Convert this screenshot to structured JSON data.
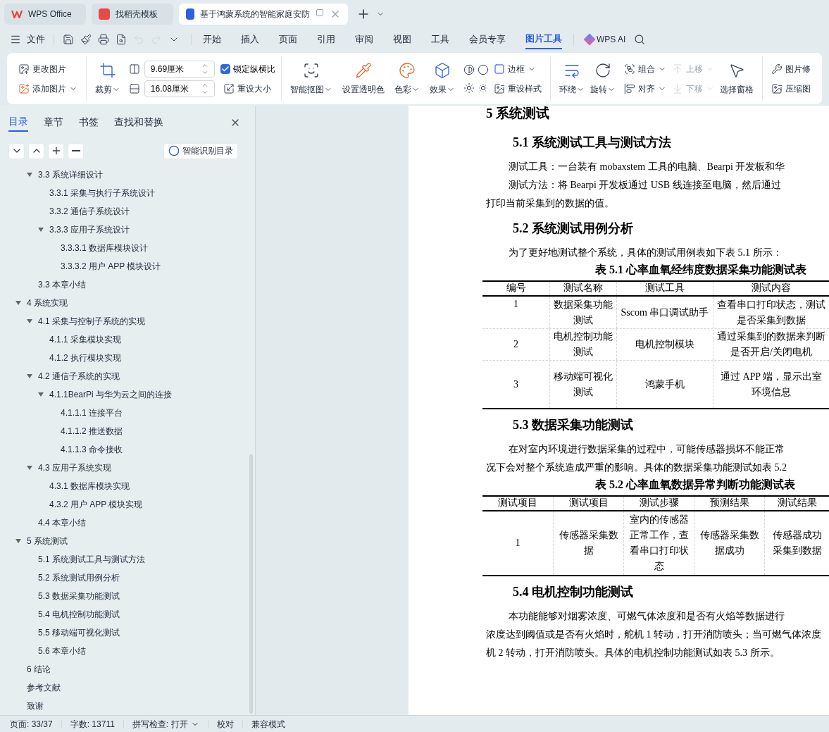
{
  "title_tabs": [
    {
      "label": "WPS Office",
      "kind": "home",
      "selected": false
    },
    {
      "label": "找稻壳模板",
      "kind": "template",
      "selected": false
    },
    {
      "label": "基于鸿蒙系统的智能家庭安防",
      "kind": "doc",
      "selected": true
    }
  ],
  "menu": {
    "file": "文件",
    "tabs": [
      {
        "label": "开始",
        "selected": false
      },
      {
        "label": "插入",
        "selected": false
      },
      {
        "label": "页面",
        "selected": false
      },
      {
        "label": "引用",
        "selected": false
      },
      {
        "label": "审阅",
        "selected": false
      },
      {
        "label": "视图",
        "selected": false
      },
      {
        "label": "工具",
        "selected": false
      },
      {
        "label": "会员专享",
        "selected": false
      },
      {
        "label": "图片工具",
        "selected": true
      }
    ],
    "ai": "WPS AI"
  },
  "ribbon": {
    "picture": [
      "更改图片",
      "添加图片"
    ],
    "crop": "裁剪",
    "height": "9.69厘米",
    "width": "16.08厘米",
    "lock": {
      "label": "锁定纵横比",
      "checked": true
    },
    "reset_size": "重设大小",
    "adjust": [
      "智能抠图",
      "设置透明色",
      "色彩",
      "效果"
    ],
    "border": "边框",
    "reset_style": "重设样式",
    "arrange": [
      "环绕",
      "旋转"
    ],
    "group": "组合",
    "align": "对齐",
    "up": {
      "label": "上移",
      "disabled": true
    },
    "down": {
      "label": "下移",
      "disabled": true
    },
    "pane": "选择窗格",
    "more": [
      "图片修",
      "压缩图"
    ]
  },
  "nav": {
    "tabs": [
      {
        "label": "目录",
        "selected": true
      },
      {
        "label": "章节",
        "selected": false
      },
      {
        "label": "书签",
        "selected": false
      },
      {
        "label": "查找和替换",
        "selected": false
      }
    ],
    "smart": "智能识别目录",
    "continued": [
      {
        "label": "3.3 系统详细设计",
        "expanded": true,
        "children": [
          {
            "label": "3.3.1 采集与执行子系统设计"
          },
          {
            "label": "3.3.2 通信子系统设计"
          },
          {
            "label": "3.3.3 应用子系统设计",
            "expanded": true,
            "children": [
              {
                "label": "3.3.3.1 数据库模块设计"
              },
              {
                "label": "3.3.3.2 用户 APP 模块设计"
              }
            ]
          }
        ]
      },
      {
        "label": "3.3 本章小结"
      }
    ],
    "items": [
      {
        "label": "4 系统实现",
        "expanded": true,
        "children": [
          {
            "label": "4.1 采集与控制子系统的实现",
            "expanded": true,
            "children": [
              {
                "label": "4.1.1 采集模块实现"
              },
              {
                "label": "4.1.2 执行模块实现"
              }
            ]
          },
          {
            "label": "4.2 通信子系统的实现",
            "expanded": true,
            "children": [
              {
                "label": "4.1.1BearPi 与华为云之间的连接",
                "expanded": true,
                "children": [
                  {
                    "label": "4.1.1.1 连接平台"
                  },
                  {
                    "label": "4.1.1.2 推送数据"
                  },
                  {
                    "label": "4.1.1.3 命令接收"
                  }
                ]
              }
            ]
          },
          {
            "label": "4.3 应用子系统实现",
            "expanded": true,
            "children": [
              {
                "label": "4.3.1 数据库模块实现"
              },
              {
                "label": "4.3.2 用户 APP 模块实现"
              }
            ]
          },
          {
            "label": "4.4 本章小结"
          }
        ]
      },
      {
        "label": "5 系统测试",
        "expanded": true,
        "children": [
          {
            "label": "5.1 系统测试工具与测试方法"
          },
          {
            "label": "5.2 系统测试用例分析"
          },
          {
            "label": "5.3 数据采集功能测试"
          },
          {
            "label": "5.4 电机控制功能测试"
          },
          {
            "label": "5.5 移动端可视化测试"
          },
          {
            "label": "5.6 本章小结"
          }
        ]
      },
      {
        "label": "6 结论"
      },
      {
        "label": "参考文献"
      },
      {
        "label": "致谢"
      }
    ]
  },
  "document": [
    {
      "kind": "chapter",
      "text": "5 系统测试"
    },
    {
      "kind": "heading",
      "text": "5.1 系统测试工具与测试方法"
    },
    {
      "kind": "para",
      "lines": [
        "测试工具：一台装有 mobaxstem 工具的电脑、Bearpi 开发板和华"
      ]
    },
    {
      "kind": "para",
      "lines": [
        "测试方法：将 Bearpi 开发板通过 USB 线连接至电脑，然后通过",
        "打印当前采集到的数据的值。"
      ]
    },
    {
      "kind": "heading",
      "text": "5.2 系统测试用例分析"
    },
    {
      "kind": "para",
      "lines": [
        "为了更好地测试整个系统，具体的测试用例表如下表 5.1 所示："
      ]
    },
    {
      "kind": "caption",
      "text": "表 5.1 心率血氧经纬度数据采集功能测试表"
    },
    {
      "kind": "table",
      "columns": [
        "编号",
        "测试名称",
        "测试工具",
        "测试内容"
      ],
      "rows": [
        [
          "1",
          "数据采集功能测试",
          "Sscom 串口调试助手",
          "查看串口打印状态，测试是否采集到数据"
        ],
        [
          "2",
          "电机控制功能测试",
          "电机控制模块",
          "通过采集到的数据来判断是否开启/关闭电机"
        ],
        [
          "3",
          "移动端可视化测试",
          "鸿蒙手机",
          "通过 APP 端，显示出室环境信息"
        ]
      ]
    },
    {
      "kind": "heading",
      "text": "5.3 数据采集功能测试"
    },
    {
      "kind": "para",
      "lines": [
        "在对室内环境进行数据采集的过程中，可能传感器损坏不能正常",
        "况下会对整个系统造成严重的影响。具体的数据采集功能测试如表 5.2"
      ]
    },
    {
      "kind": "caption",
      "text": "表 5.2 心率血氧数据异常判断功能测试表"
    },
    {
      "kind": "table",
      "columns": [
        "测试项目",
        "测试项目",
        "测试步骤",
        "预测结果",
        "测试结果"
      ],
      "rows": [
        [
          "1",
          "传感器采集数据",
          "室内的传感器正常工作，查看串口打印状态",
          "传感器采集数据成功",
          "传感器成功采集到数据"
        ]
      ]
    },
    {
      "kind": "heading",
      "text": "5.4 电机控制功能测试"
    },
    {
      "kind": "para",
      "lines": [
        "本功能能够对烟雾浓度、可燃气体浓度和是否有火焰等数据进行",
        "浓度达到阈值或是否有火焰时，舵机 1 转动，打开消防喷头；当可燃气体浓度",
        "机 2 转动，打开消防喷头。具体的电机控制功能测试如表 5.3 所示。"
      ]
    }
  ],
  "status": {
    "page": "页面: 33/37",
    "words": "字数: 13711",
    "spell": "拼写检查: 打开",
    "proof": "校对",
    "compat": "兼容模式"
  }
}
